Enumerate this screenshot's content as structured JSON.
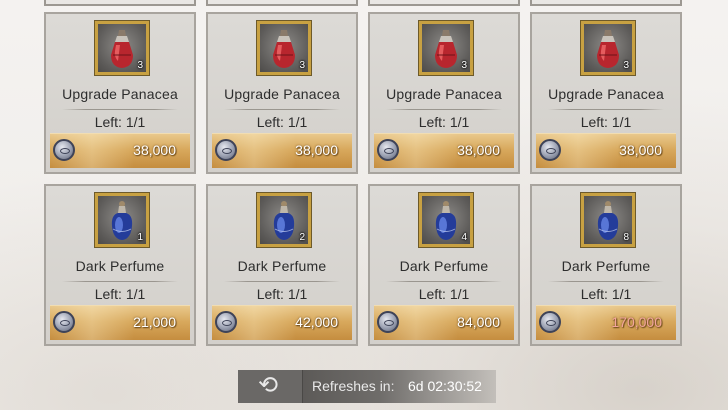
{
  "shop": {
    "items": [
      {
        "name": "Upgrade Panacea",
        "quantity": "3",
        "left": "Left: 1/1",
        "price": "38,000",
        "potion": "red-potion-icon",
        "price_color": "#ffffff"
      },
      {
        "name": "Upgrade Panacea",
        "quantity": "3",
        "left": "Left: 1/1",
        "price": "38,000",
        "potion": "red-potion-icon",
        "price_color": "#ffffff"
      },
      {
        "name": "Upgrade Panacea",
        "quantity": "3",
        "left": "Left: 1/1",
        "price": "38,000",
        "potion": "red-potion-icon",
        "price_color": "#ffffff"
      },
      {
        "name": "Upgrade Panacea",
        "quantity": "3",
        "left": "Left: 1/1",
        "price": "38,000",
        "potion": "red-potion-icon",
        "price_color": "#ffffff"
      },
      {
        "name": "Dark Perfume",
        "quantity": "1",
        "left": "Left: 1/1",
        "price": "21,000",
        "potion": "blue-perfume-icon",
        "price_color": "#ffffff"
      },
      {
        "name": "Dark Perfume",
        "quantity": "2",
        "left": "Left: 1/1",
        "price": "42,000",
        "potion": "blue-perfume-icon",
        "price_color": "#ffffff"
      },
      {
        "name": "Dark Perfume",
        "quantity": "4",
        "left": "Left: 1/1",
        "price": "84,000",
        "potion": "blue-perfume-icon",
        "price_color": "#ffffff"
      },
      {
        "name": "Dark Perfume",
        "quantity": "8",
        "left": "Left: 1/1",
        "price": "170,000",
        "potion": "blue-perfume-icon",
        "price_color": "#f3a59c"
      }
    ],
    "currency_icon": "silver-coin-icon"
  },
  "refresh": {
    "icon": "refresh-icon",
    "label": "Refreshes in:",
    "time": "6d 02:30:52"
  },
  "colors": {
    "card_border": "#a8a49e",
    "icon_frame": "#c8a142",
    "price_bar": "#d8a95d",
    "price_over_budget": "#f3a59c"
  }
}
